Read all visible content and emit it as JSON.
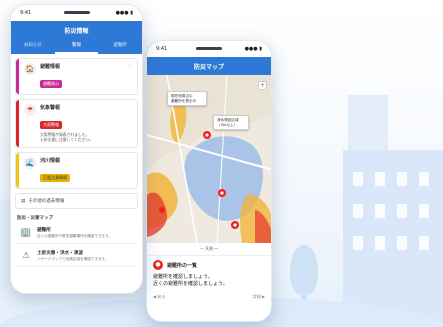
{
  "phone_list": {
    "status": {
      "time": "9:41",
      "signal": "●●● ▮"
    },
    "header_title": "防災情報",
    "tabs": [
      "お知らせ",
      "警報",
      "避難所"
    ],
    "alerts": [
      {
        "title": "避難情報",
        "badge": "避難指示",
        "stripe": "#c72a9a",
        "badge_color": "#c72a9a",
        "icon_bg": "#e7f4e6",
        "icon": "🏠",
        "more": "⋯",
        "body": ""
      },
      {
        "title": "気象警報",
        "badge": "大雨警報",
        "stripe": "#d62828",
        "badge_color": "#d62828",
        "icon_bg": "#fdeaea",
        "icon": "☂",
        "more": "",
        "body": "大雨警報が発表されました。\n土砂災害に注意してください。"
      },
      {
        "title": "河川情報",
        "badge": "氾濫注意情報",
        "stripe": "#f0c419",
        "badge_color": "#e5b400",
        "icon_bg": "#e8f0fb",
        "icon": "🌊",
        "more": "",
        "body": ""
      }
    ],
    "link_row": "その他の過去情報",
    "section_title": "防災・災害マップ",
    "list": [
      {
        "icon": "🏢",
        "title": "避難所",
        "desc": "近くの避難所や緊急避難場所を確認できます。"
      },
      {
        "icon": "⚠",
        "title": "土砂災害・洪水・津波",
        "desc": "ハザードマップで危険区域を確認できます。"
      }
    ]
  },
  "phone_map": {
    "status": {
      "time": "9:41",
      "signal": "●●● ▮"
    },
    "header_title": "防災マップ",
    "tooltips": [
      "現在地周辺の\n避難所を表示中",
      "浸水想定区域\n（3m以上）"
    ],
    "map_caption": "— 凡例 —",
    "info_title": "避難所の一覧",
    "info_text": "避難所を確認しましょう。\n近くの避難所を確認しましょう。",
    "footer_left": "◀ 戻る",
    "footer_right": "詳細 ▶"
  }
}
